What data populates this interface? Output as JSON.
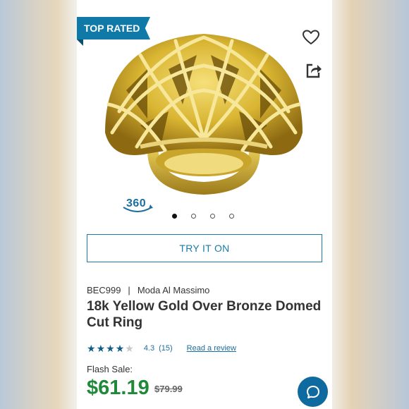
{
  "ribbon": {
    "label": "TOP RATED"
  },
  "carousel": {
    "badge_360": "360",
    "dot_count": 4,
    "active_index": 0
  },
  "actions": {
    "try_on": "TRY IT ON"
  },
  "product": {
    "sku": "BEC999",
    "separator": "|",
    "brand": "Moda Al Massimo",
    "title": "18k Yellow Gold Over Bronze Domed Cut Ring"
  },
  "rating": {
    "value": "4.3",
    "count": "(15)",
    "stars": 4.3,
    "review_link": "Read a review"
  },
  "pricing": {
    "flash_label": "Flash Sale:",
    "price": "$61.19",
    "original_price": "$79.99"
  },
  "colors": {
    "accent": "#0f7aa8",
    "price_green": "#1f8a3a",
    "gold": "#d8b838"
  },
  "icons": {
    "favorite": "heart-outline-icon",
    "share": "share-icon",
    "chat": "chat-icon"
  }
}
